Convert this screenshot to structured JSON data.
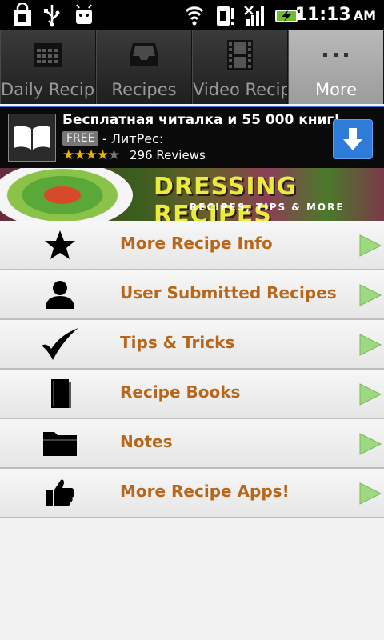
{
  "status_bar": {
    "time": "11:13",
    "ampm": "AM"
  },
  "tabs": [
    {
      "label": "Daily Recipes",
      "icon": "calendar-icon",
      "selected": false
    },
    {
      "label": "Recipes",
      "icon": "tray-icon",
      "selected": false
    },
    {
      "label": "Video Recipe",
      "icon": "film-icon",
      "selected": false
    },
    {
      "label": "More",
      "icon": "more-dots-icon",
      "selected": true
    }
  ],
  "ad": {
    "title": "Бесплатная читалка и 55 000 книг!",
    "free_badge": "FREE",
    "publisher": "- ЛитРес:",
    "rating_stars": 3.5,
    "reviews_count": "296",
    "reviews_label": "Reviews"
  },
  "banner": {
    "title": "DRESSING RECIPES",
    "subtitle": "RECIPES, TIPS & MORE"
  },
  "menu": [
    {
      "label": "More Recipe Info",
      "icon": "star-icon"
    },
    {
      "label": "User Submitted Recipes",
      "icon": "user-icon"
    },
    {
      "label": "Tips & Tricks",
      "icon": "checkmark-icon"
    },
    {
      "label": "Recipe Books",
      "icon": "book-icon"
    },
    {
      "label": "Notes",
      "icon": "folder-icon"
    },
    {
      "label": "More Recipe Apps!",
      "icon": "thumbs-up-icon"
    }
  ],
  "colors": {
    "menu_label": "#b8661a",
    "arrow": "#8fd070",
    "ad_border": "#3b6fd6"
  }
}
